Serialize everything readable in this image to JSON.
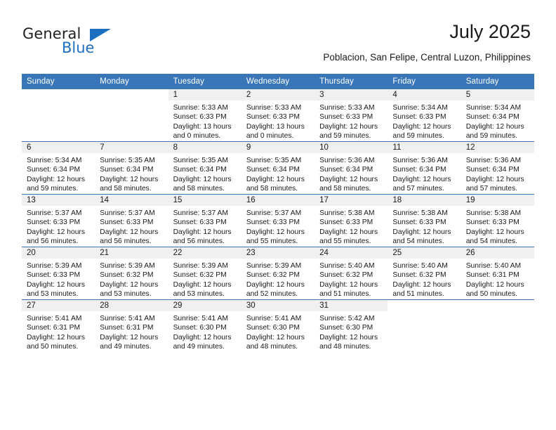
{
  "brand": {
    "name_part1": "General",
    "name_part2": "Blue",
    "logo_icon": "blue-triangle-icon",
    "accent_color": "#1a6fc0"
  },
  "header": {
    "title": "July 2025",
    "subtitle": "Poblacion, San Felipe, Central Luzon, Philippines"
  },
  "calendar": {
    "header_bg": "#3876b8",
    "daynum_bg": "#f0f0f0",
    "weekday_headers": [
      "Sunday",
      "Monday",
      "Tuesday",
      "Wednesday",
      "Thursday",
      "Friday",
      "Saturday"
    ],
    "weeks": [
      [
        {
          "day": "",
          "sunrise": "",
          "sunset": "",
          "daylight_line1": "",
          "daylight_line2": ""
        },
        {
          "day": "",
          "sunrise": "",
          "sunset": "",
          "daylight_line1": "",
          "daylight_line2": ""
        },
        {
          "day": "1",
          "sunrise": "Sunrise: 5:33 AM",
          "sunset": "Sunset: 6:33 PM",
          "daylight_line1": "Daylight: 13 hours",
          "daylight_line2": "and 0 minutes."
        },
        {
          "day": "2",
          "sunrise": "Sunrise: 5:33 AM",
          "sunset": "Sunset: 6:33 PM",
          "daylight_line1": "Daylight: 13 hours",
          "daylight_line2": "and 0 minutes."
        },
        {
          "day": "3",
          "sunrise": "Sunrise: 5:33 AM",
          "sunset": "Sunset: 6:33 PM",
          "daylight_line1": "Daylight: 12 hours",
          "daylight_line2": "and 59 minutes."
        },
        {
          "day": "4",
          "sunrise": "Sunrise: 5:34 AM",
          "sunset": "Sunset: 6:33 PM",
          "daylight_line1": "Daylight: 12 hours",
          "daylight_line2": "and 59 minutes."
        },
        {
          "day": "5",
          "sunrise": "Sunrise: 5:34 AM",
          "sunset": "Sunset: 6:34 PM",
          "daylight_line1": "Daylight: 12 hours",
          "daylight_line2": "and 59 minutes."
        }
      ],
      [
        {
          "day": "6",
          "sunrise": "Sunrise: 5:34 AM",
          "sunset": "Sunset: 6:34 PM",
          "daylight_line1": "Daylight: 12 hours",
          "daylight_line2": "and 59 minutes."
        },
        {
          "day": "7",
          "sunrise": "Sunrise: 5:35 AM",
          "sunset": "Sunset: 6:34 PM",
          "daylight_line1": "Daylight: 12 hours",
          "daylight_line2": "and 58 minutes."
        },
        {
          "day": "8",
          "sunrise": "Sunrise: 5:35 AM",
          "sunset": "Sunset: 6:34 PM",
          "daylight_line1": "Daylight: 12 hours",
          "daylight_line2": "and 58 minutes."
        },
        {
          "day": "9",
          "sunrise": "Sunrise: 5:35 AM",
          "sunset": "Sunset: 6:34 PM",
          "daylight_line1": "Daylight: 12 hours",
          "daylight_line2": "and 58 minutes."
        },
        {
          "day": "10",
          "sunrise": "Sunrise: 5:36 AM",
          "sunset": "Sunset: 6:34 PM",
          "daylight_line1": "Daylight: 12 hours",
          "daylight_line2": "and 58 minutes."
        },
        {
          "day": "11",
          "sunrise": "Sunrise: 5:36 AM",
          "sunset": "Sunset: 6:34 PM",
          "daylight_line1": "Daylight: 12 hours",
          "daylight_line2": "and 57 minutes."
        },
        {
          "day": "12",
          "sunrise": "Sunrise: 5:36 AM",
          "sunset": "Sunset: 6:34 PM",
          "daylight_line1": "Daylight: 12 hours",
          "daylight_line2": "and 57 minutes."
        }
      ],
      [
        {
          "day": "13",
          "sunrise": "Sunrise: 5:37 AM",
          "sunset": "Sunset: 6:33 PM",
          "daylight_line1": "Daylight: 12 hours",
          "daylight_line2": "and 56 minutes."
        },
        {
          "day": "14",
          "sunrise": "Sunrise: 5:37 AM",
          "sunset": "Sunset: 6:33 PM",
          "daylight_line1": "Daylight: 12 hours",
          "daylight_line2": "and 56 minutes."
        },
        {
          "day": "15",
          "sunrise": "Sunrise: 5:37 AM",
          "sunset": "Sunset: 6:33 PM",
          "daylight_line1": "Daylight: 12 hours",
          "daylight_line2": "and 56 minutes."
        },
        {
          "day": "16",
          "sunrise": "Sunrise: 5:37 AM",
          "sunset": "Sunset: 6:33 PM",
          "daylight_line1": "Daylight: 12 hours",
          "daylight_line2": "and 55 minutes."
        },
        {
          "day": "17",
          "sunrise": "Sunrise: 5:38 AM",
          "sunset": "Sunset: 6:33 PM",
          "daylight_line1": "Daylight: 12 hours",
          "daylight_line2": "and 55 minutes."
        },
        {
          "day": "18",
          "sunrise": "Sunrise: 5:38 AM",
          "sunset": "Sunset: 6:33 PM",
          "daylight_line1": "Daylight: 12 hours",
          "daylight_line2": "and 54 minutes."
        },
        {
          "day": "19",
          "sunrise": "Sunrise: 5:38 AM",
          "sunset": "Sunset: 6:33 PM",
          "daylight_line1": "Daylight: 12 hours",
          "daylight_line2": "and 54 minutes."
        }
      ],
      [
        {
          "day": "20",
          "sunrise": "Sunrise: 5:39 AM",
          "sunset": "Sunset: 6:33 PM",
          "daylight_line1": "Daylight: 12 hours",
          "daylight_line2": "and 53 minutes."
        },
        {
          "day": "21",
          "sunrise": "Sunrise: 5:39 AM",
          "sunset": "Sunset: 6:32 PM",
          "daylight_line1": "Daylight: 12 hours",
          "daylight_line2": "and 53 minutes."
        },
        {
          "day": "22",
          "sunrise": "Sunrise: 5:39 AM",
          "sunset": "Sunset: 6:32 PM",
          "daylight_line1": "Daylight: 12 hours",
          "daylight_line2": "and 53 minutes."
        },
        {
          "day": "23",
          "sunrise": "Sunrise: 5:39 AM",
          "sunset": "Sunset: 6:32 PM",
          "daylight_line1": "Daylight: 12 hours",
          "daylight_line2": "and 52 minutes."
        },
        {
          "day": "24",
          "sunrise": "Sunrise: 5:40 AM",
          "sunset": "Sunset: 6:32 PM",
          "daylight_line1": "Daylight: 12 hours",
          "daylight_line2": "and 51 minutes."
        },
        {
          "day": "25",
          "sunrise": "Sunrise: 5:40 AM",
          "sunset": "Sunset: 6:32 PM",
          "daylight_line1": "Daylight: 12 hours",
          "daylight_line2": "and 51 minutes."
        },
        {
          "day": "26",
          "sunrise": "Sunrise: 5:40 AM",
          "sunset": "Sunset: 6:31 PM",
          "daylight_line1": "Daylight: 12 hours",
          "daylight_line2": "and 50 minutes."
        }
      ],
      [
        {
          "day": "27",
          "sunrise": "Sunrise: 5:41 AM",
          "sunset": "Sunset: 6:31 PM",
          "daylight_line1": "Daylight: 12 hours",
          "daylight_line2": "and 50 minutes."
        },
        {
          "day": "28",
          "sunrise": "Sunrise: 5:41 AM",
          "sunset": "Sunset: 6:31 PM",
          "daylight_line1": "Daylight: 12 hours",
          "daylight_line2": "and 49 minutes."
        },
        {
          "day": "29",
          "sunrise": "Sunrise: 5:41 AM",
          "sunset": "Sunset: 6:30 PM",
          "daylight_line1": "Daylight: 12 hours",
          "daylight_line2": "and 49 minutes."
        },
        {
          "day": "30",
          "sunrise": "Sunrise: 5:41 AM",
          "sunset": "Sunset: 6:30 PM",
          "daylight_line1": "Daylight: 12 hours",
          "daylight_line2": "and 48 minutes."
        },
        {
          "day": "31",
          "sunrise": "Sunrise: 5:42 AM",
          "sunset": "Sunset: 6:30 PM",
          "daylight_line1": "Daylight: 12 hours",
          "daylight_line2": "and 48 minutes."
        },
        {
          "day": "",
          "sunrise": "",
          "sunset": "",
          "daylight_line1": "",
          "daylight_line2": ""
        },
        {
          "day": "",
          "sunrise": "",
          "sunset": "",
          "daylight_line1": "",
          "daylight_line2": ""
        }
      ]
    ]
  }
}
